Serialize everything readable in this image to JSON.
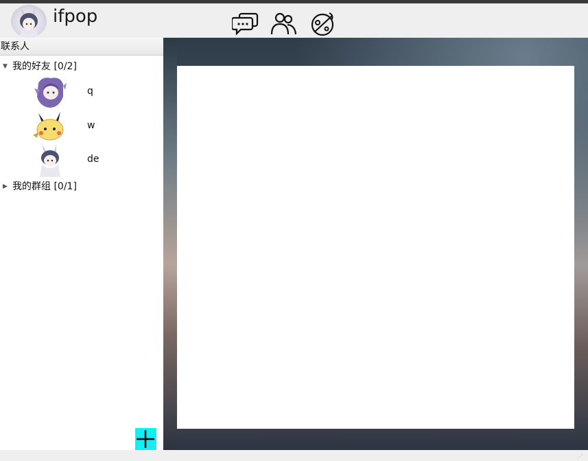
{
  "header": {
    "app_name": "ifpop",
    "nav": [
      {
        "icon": "chat-bubbles-icon"
      },
      {
        "icon": "contacts-icon"
      },
      {
        "icon": "planet-icon"
      }
    ]
  },
  "sidebar": {
    "title": "联系人",
    "groups": [
      {
        "label": "我的好友 [0/2]",
        "expanded": true,
        "contacts": [
          {
            "name": "q",
            "avatar": "purple-hood-avatar"
          },
          {
            "name": "w",
            "avatar": "pikachu-avatar"
          },
          {
            "name": "de",
            "avatar": "bunny-hood-avatar"
          }
        ]
      },
      {
        "label": "我的群组 [0/1]",
        "expanded": false,
        "contacts": []
      }
    ],
    "add_button_icon": "plus-icon"
  },
  "colors": {
    "accent_add": "#0ff0f5",
    "sidebar_bg": "#ffffff",
    "window_bg": "#efefef"
  }
}
